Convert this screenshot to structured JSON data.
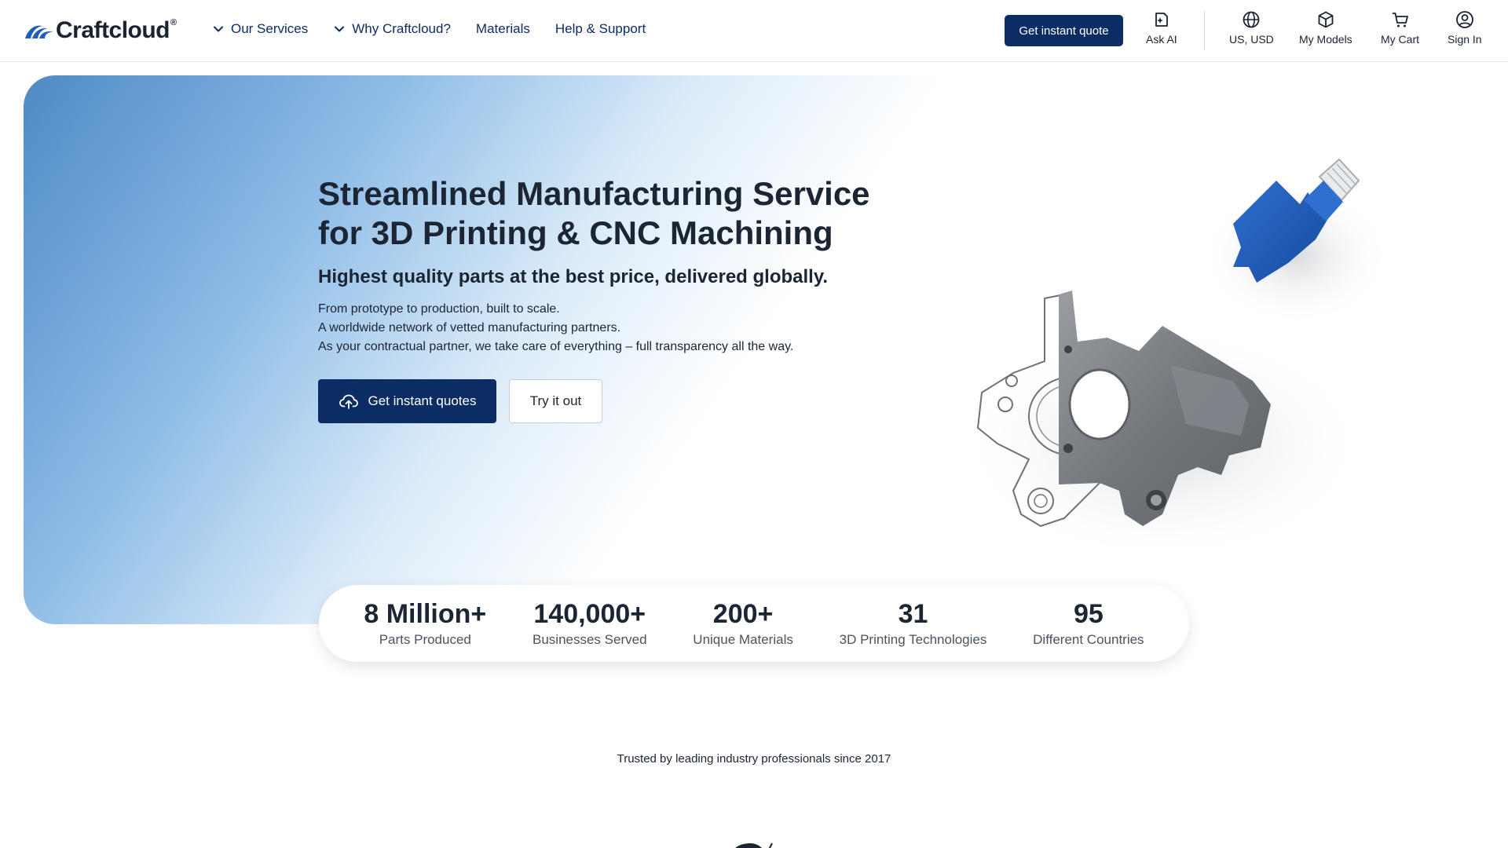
{
  "header": {
    "logo_text": "Craftcloud",
    "logo_mark": "®",
    "nav": [
      {
        "label": "Our Services",
        "has_chevron": true
      },
      {
        "label": "Why Craftcloud?",
        "has_chevron": true
      },
      {
        "label": "Materials",
        "has_chevron": false
      },
      {
        "label": "Help & Support",
        "has_chevron": false
      }
    ],
    "cta_label": "Get instant quote",
    "tools": {
      "ask_ai": "Ask AI",
      "region": "US, USD",
      "models": "My Models",
      "cart": "My Cart",
      "sign_in": "Sign In"
    }
  },
  "hero": {
    "title_line1": "Streamlined Manufacturing Service",
    "title_line2": "for 3D Printing & CNC Machining",
    "subtitle": "Highest quality parts at the best price, delivered globally.",
    "lines": [
      "From prototype to production, built to scale.",
      "A worldwide network of vetted manufacturing partners.",
      "As your contractual partner, we take care of everything – full transparency all the way."
    ],
    "primary_button": "Get instant quotes",
    "secondary_button": "Try it out"
  },
  "stats": [
    {
      "value": "8 Million+",
      "label": "Parts Produced"
    },
    {
      "value": "140,000+",
      "label": "Businesses Served"
    },
    {
      "value": "200+",
      "label": "Unique Materials"
    },
    {
      "value": "31",
      "label": "3D Printing Technologies"
    },
    {
      "value": "95",
      "label": "Different Countries"
    }
  ],
  "trusted_text": "Trusted by leading industry professionals since 2017",
  "colors": {
    "brand_navy": "#0b2d63",
    "hero_gradient_start": "#4f8ac7",
    "part_blue": "#1f5db8",
    "part_metal": "#7d8186"
  },
  "icons": {
    "logo": "craftcloud-wave-logo",
    "nav_chevron": "chevron-down-icon",
    "ask_ai": "ai-sparkle-icon",
    "region": "globe-icon",
    "models": "cube-icon",
    "cart": "cart-icon",
    "sign_in": "user-circle-icon",
    "upload": "cloud-upload-icon"
  }
}
